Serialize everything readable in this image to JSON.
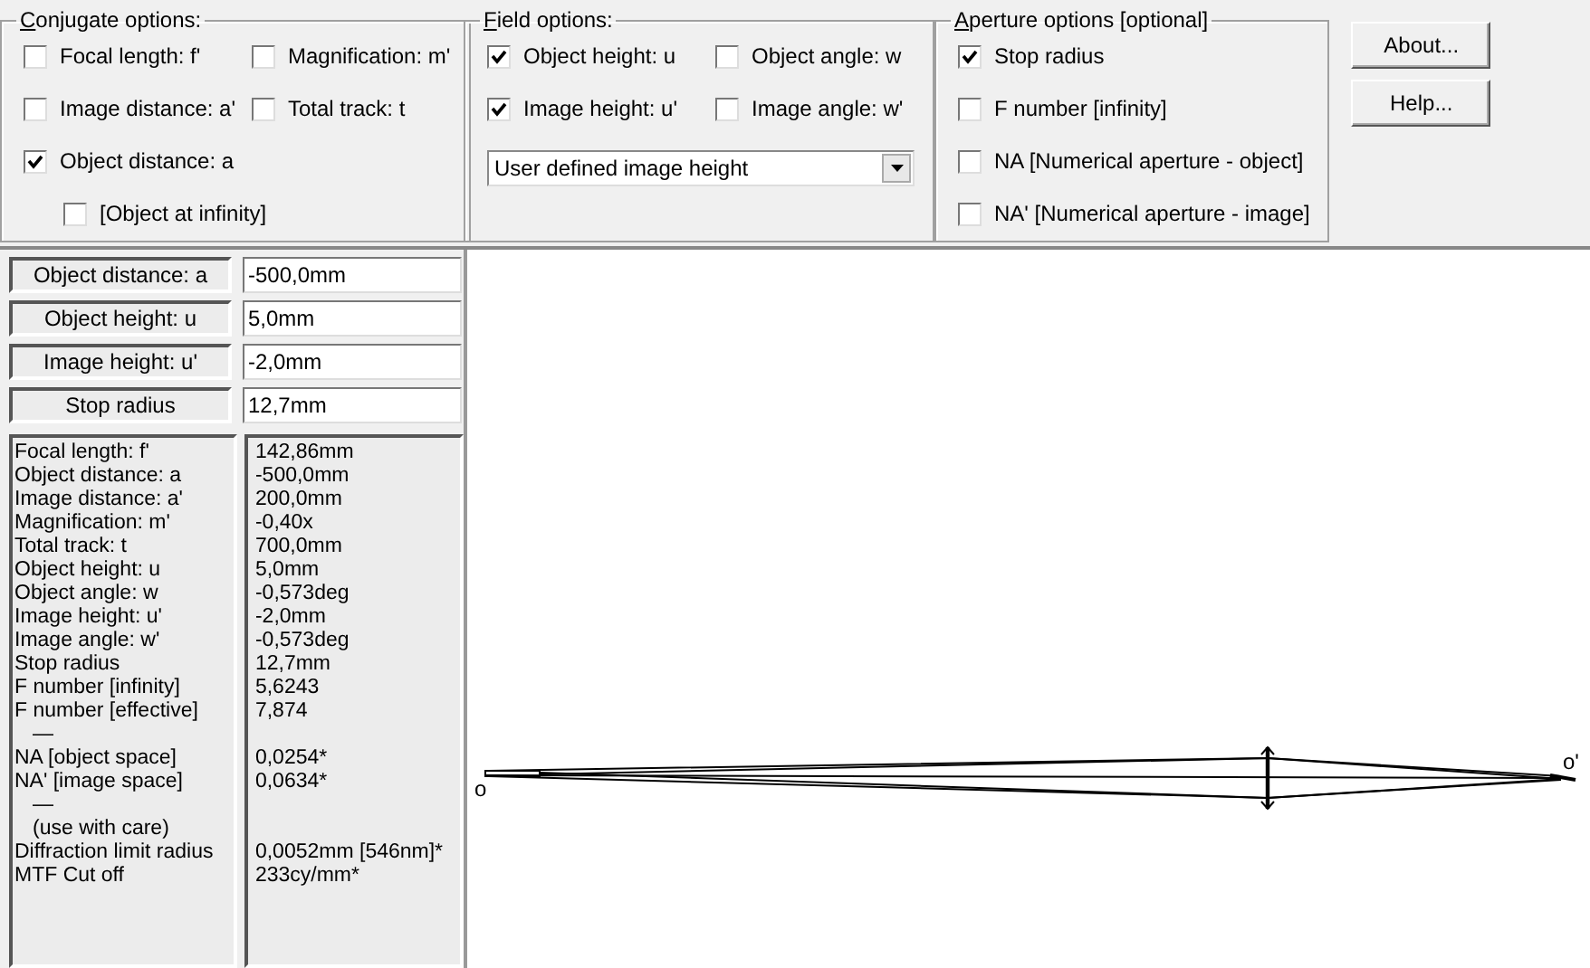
{
  "conjugate_options": {
    "title": "Conjugate options:",
    "checkboxes": [
      {
        "label": "Focal length: f'",
        "checked": false
      },
      {
        "label": "Magnification: m'",
        "checked": false
      },
      {
        "label": "Image distance: a'",
        "checked": false
      },
      {
        "label": "Total track: t",
        "checked": false
      },
      {
        "label": "Object distance: a",
        "checked": true,
        "children": [
          {
            "label": "[Object at infinity]",
            "checked": false
          }
        ]
      }
    ]
  },
  "field_options": {
    "title": "Field options:",
    "checkboxes": [
      {
        "label": "Object height: u",
        "checked": true
      },
      {
        "label": "Object angle: w",
        "checked": false
      },
      {
        "label": "Image height: u'",
        "checked": true
      },
      {
        "label": "Image angle: w'",
        "checked": false
      }
    ],
    "dropdown": {
      "value": "User defined image height"
    }
  },
  "aperture_options": {
    "title": "Aperture options [optional]",
    "checkboxes": [
      {
        "label": "Stop radius",
        "checked": true
      },
      {
        "label": "F number [infinity]",
        "checked": false
      },
      {
        "label": "NA [Numerical aperture - object]",
        "checked": false
      },
      {
        "label": "NA' [Numerical aperture - image]",
        "checked": false
      }
    ]
  },
  "buttons": [
    "About...",
    "Help..."
  ],
  "inputs": [
    {
      "label": "Object distance: a",
      "value": "-500,0mm"
    },
    {
      "label": "Object height: u",
      "value": "5,0mm"
    },
    {
      "label": "Image height: u'",
      "value": "-2,0mm"
    },
    {
      "label": "Stop radius",
      "value": "12,7mm"
    }
  ],
  "results": [
    {
      "kind": "row",
      "label": "Focal length: f'",
      "value": "142,86mm"
    },
    {
      "kind": "row",
      "label": "Object distance: a",
      "value": "-500,0mm"
    },
    {
      "kind": "row",
      "label": "Image distance: a'",
      "value": "200,0mm"
    },
    {
      "kind": "row",
      "label": "Magnification: m'",
      "value": "-0,40x"
    },
    {
      "kind": "row",
      "label": "Total track: t",
      "value": "700,0mm"
    },
    {
      "kind": "row",
      "label": "Object height: u",
      "value": "5,0mm"
    },
    {
      "kind": "row",
      "label": "Object angle: w",
      "value": "-0,573deg"
    },
    {
      "kind": "row",
      "label": "Image height: u'",
      "value": "-2,0mm"
    },
    {
      "kind": "row",
      "label": "Image angle: w'",
      "value": "-0,573deg"
    },
    {
      "kind": "row",
      "label": "Stop radius",
      "value": "12,7mm"
    },
    {
      "kind": "row",
      "label": "F number [infinity]",
      "value": "5,6243"
    },
    {
      "kind": "row",
      "label": "F number [effective]",
      "value": "7,874"
    },
    {
      "kind": "note",
      "label": "—"
    },
    {
      "kind": "row",
      "label": "NA [object space]",
      "value": "0,0254*"
    },
    {
      "kind": "row",
      "label": "NA' [image space]",
      "value": "0,0634*"
    },
    {
      "kind": "note",
      "label": "—"
    },
    {
      "kind": "note",
      "label": "(use with care)"
    },
    {
      "kind": "row",
      "label": "Diffraction limit radius",
      "value": "0,0052mm [546nm]*"
    },
    {
      "kind": "row",
      "label": "MTF Cut off",
      "value": "233cy/mm*"
    }
  ],
  "diagram": {
    "object_label": "o",
    "image_label": "o'"
  }
}
